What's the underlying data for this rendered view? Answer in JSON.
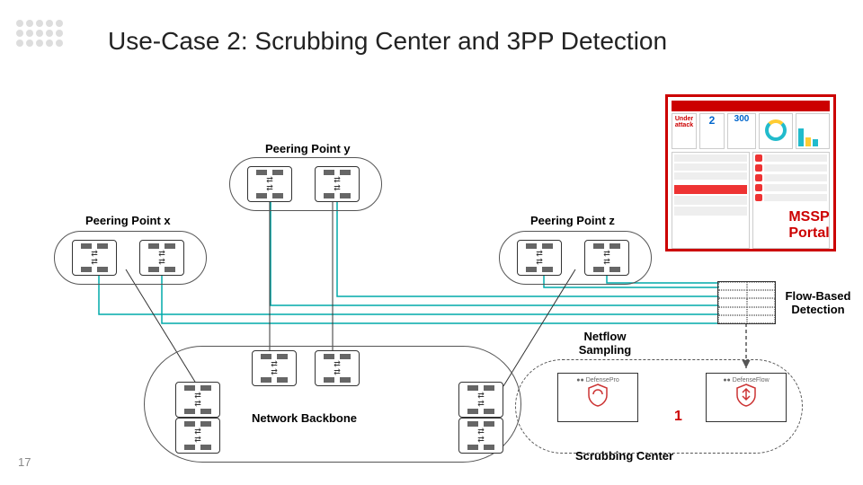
{
  "title": "Use-Case 2: Scrubbing Center and 3PP Detection",
  "page_number": "17",
  "labels": {
    "pp_x": "Peering Point x",
    "pp_y": "Peering Point y",
    "pp_z": "Peering Point z",
    "backbone": "Network Backbone",
    "netflow": "Netflow Sampling",
    "flow_detection": "Flow-Based Detection",
    "portal": "MSSP Portal",
    "scrubbing": "Scrubbing Center",
    "one": "1",
    "defensepro": "DefensePro",
    "defenseflow": "DefenseFlow"
  },
  "portal_ui": {
    "header": "Under attack",
    "stat1": "2",
    "stat2": "300"
  }
}
